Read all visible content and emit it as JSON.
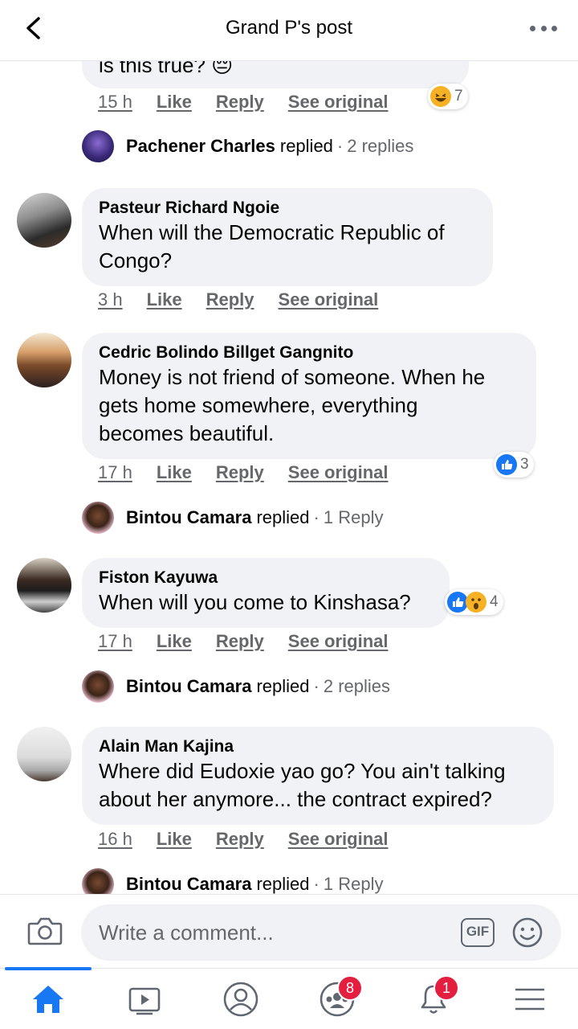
{
  "header": {
    "title": "Grand P's post"
  },
  "top_partial": {
    "text": "is this true? 😔",
    "actions": {
      "time": "15 h",
      "like": "Like",
      "reply": "Reply",
      "see_original": "See original"
    },
    "reaction_count": "7",
    "reaction_icons": [
      "haha-icon"
    ]
  },
  "top_reply": {
    "name": "Pachener Charles",
    "verb": "replied",
    "dot": "·",
    "count": "2 replies"
  },
  "comments": [
    {
      "name": "Pasteur Richard Ngoie",
      "lines": [
        "When will the Democratic Republic of",
        "Congo?"
      ],
      "actions": {
        "time": "3 h",
        "like": "Like",
        "reply": "Reply",
        "see_original": "See original"
      }
    },
    {
      "name": "Cedric Bolindo Billget Gangnito",
      "lines": [
        "Money is not friend of someone. When he",
        "gets home somewhere, everything",
        "becomes beautiful."
      ],
      "actions": {
        "time": "17 h",
        "like": "Like",
        "reply": "Reply",
        "see_original": "See original"
      },
      "reaction_count": "3",
      "reaction_icons": [
        "like-icon"
      ],
      "reply": {
        "name": "Bintou Camara",
        "verb": "replied",
        "dot": "·",
        "count": "1 Reply"
      }
    },
    {
      "name": "Fiston Kayuwa",
      "lines": [
        "When will you come to Kinshasa?"
      ],
      "actions": {
        "time": "17 h",
        "like": "Like",
        "reply": "Reply",
        "see_original": "See original"
      },
      "reaction_count": "4",
      "reaction_icons": [
        "like-icon",
        "wow-icon"
      ],
      "reply": {
        "name": "Bintou Camara",
        "verb": "replied",
        "dot": "·",
        "count": "2 replies"
      }
    },
    {
      "name": "Alain Man Kajina",
      "lines": [
        "Where did Eudoxie yao go? You ain't talking",
        "about her anymore... the contract expired?"
      ],
      "actions": {
        "time": "16 h",
        "like": "Like",
        "reply": "Reply",
        "see_original": "See original"
      },
      "reply": {
        "name": "Bintou Camara",
        "verb": "replied",
        "dot": "·",
        "count": "1 Reply"
      }
    }
  ],
  "composer": {
    "placeholder": "Write a comment...",
    "gif_label": "GIF"
  },
  "nav": {
    "items": [
      "home-icon",
      "watch-icon",
      "profile-icon",
      "groups-icon",
      "notifications-icon",
      "menu-icon"
    ],
    "groups_badge": "8",
    "notifications_badge": "1"
  },
  "colors": {
    "accent": "#1877f2",
    "badge": "#e41e3f",
    "bubble": "#f0f2f5",
    "secondary_text": "#65676b"
  }
}
